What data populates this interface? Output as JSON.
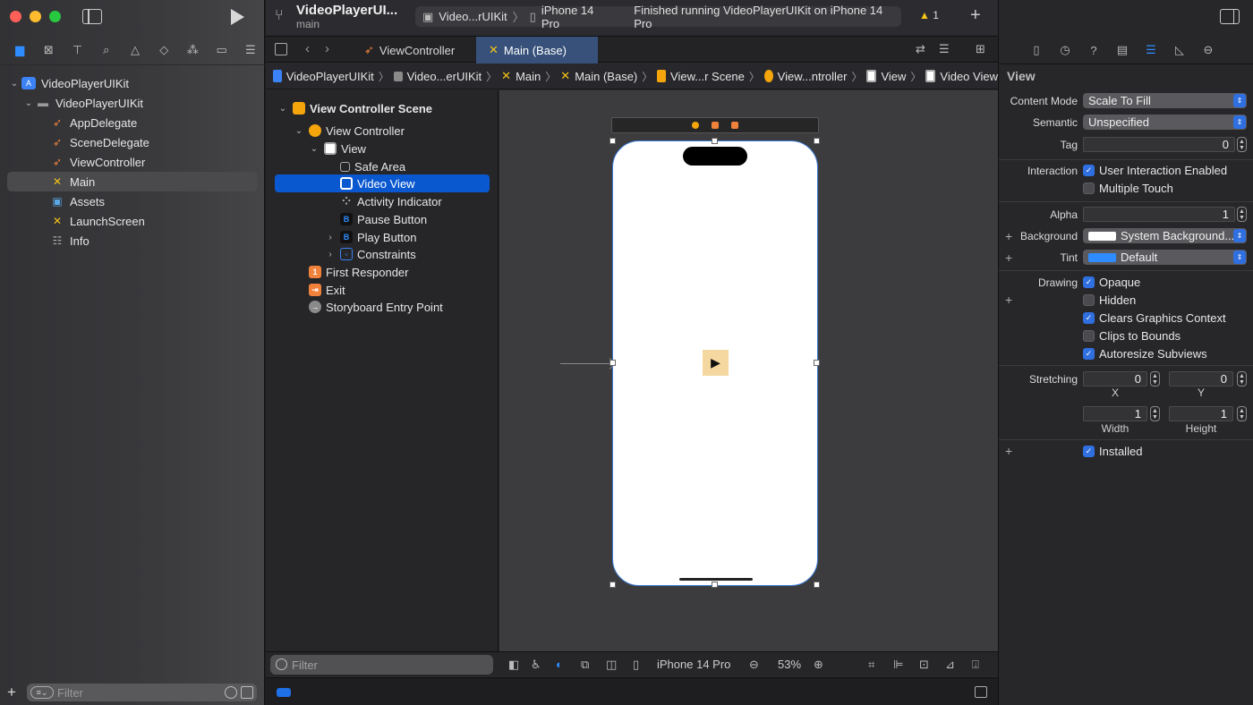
{
  "navigator": {
    "tabs": [
      "folder-icon",
      "source-control-icon",
      "symbol-icon",
      "search-icon",
      "issue-icon",
      "test-icon",
      "debug-icon",
      "breakpoint-icon",
      "report-icon"
    ],
    "tree": [
      {
        "label": "VideoPlayerUIKit",
        "level": 0,
        "icon": "project-icon",
        "chevron": "⌄"
      },
      {
        "label": "VideoPlayerUIKit",
        "level": 1,
        "icon": "folder-icon",
        "chevron": "⌄"
      },
      {
        "label": "AppDelegate",
        "level": 2,
        "icon": "swift-file-icon"
      },
      {
        "label": "SceneDelegate",
        "level": 2,
        "icon": "swift-file-icon"
      },
      {
        "label": "ViewController",
        "level": 2,
        "icon": "swift-file-icon"
      },
      {
        "label": "Main",
        "level": 2,
        "icon": "storyboard-icon",
        "selected": true
      },
      {
        "label": "Assets",
        "level": 2,
        "icon": "assets-icon"
      },
      {
        "label": "LaunchScreen",
        "level": 2,
        "icon": "storyboard-icon"
      },
      {
        "label": "Info",
        "level": 2,
        "icon": "plist-icon"
      }
    ],
    "filter_placeholder": "Filter"
  },
  "toolbar": {
    "project_title": "VideoPlayerUIKit",
    "project_title_display": "VideoPlayerUI...",
    "branch": "main",
    "scheme": "Video...rUIKit",
    "device": "iPhone 14 Pro",
    "status": "Finished running VideoPlayerUIKit on iPhone 14 Pro",
    "warning_count": "1"
  },
  "tabs": {
    "items": [
      {
        "label": "ViewController",
        "active": false
      },
      {
        "label": "Main (Base)",
        "active": true
      }
    ]
  },
  "jumpbar": [
    "VideoPlayerUIKit",
    "Video...erUIKit",
    "Main",
    "Main (Base)",
    "View...r Scene",
    "View...ntroller",
    "View",
    "Video View"
  ],
  "outline": {
    "rows": [
      {
        "label": "View Controller Scene",
        "chev": "⌄"
      },
      {
        "label": "View Controller",
        "chev": "⌄"
      },
      {
        "label": "View",
        "chev": "⌄"
      },
      {
        "label": "Safe Area",
        "chev": ""
      },
      {
        "label": "Video View",
        "chev": "",
        "selected": true
      },
      {
        "label": "Activity Indicator",
        "chev": ""
      },
      {
        "label": "Pause Button",
        "chev": ""
      },
      {
        "label": "Play Button",
        "chev": "›"
      },
      {
        "label": "Constraints",
        "chev": "›"
      },
      {
        "label": "First Responder",
        "chev": ""
      },
      {
        "label": "Exit",
        "chev": ""
      },
      {
        "label": "Storyboard Entry Point",
        "chev": ""
      }
    ],
    "filter_placeholder": "Filter"
  },
  "canvas": {
    "device_label": "iPhone 14 Pro",
    "zoom": "53%"
  },
  "inspector": {
    "header": "View",
    "content_mode_label": "Content Mode",
    "content_mode": "Scale To Fill",
    "semantic_label": "Semantic",
    "semantic": "Unspecified",
    "tag_label": "Tag",
    "tag": "0",
    "interaction_label": "Interaction",
    "user_interaction": "User Interaction Enabled",
    "multiple_touch": "Multiple Touch",
    "alpha_label": "Alpha",
    "alpha": "1",
    "background_label": "Background",
    "background": "System Background...",
    "tint_label": "Tint",
    "tint": "Default",
    "drawing_label": "Drawing",
    "opaque": "Opaque",
    "hidden": "Hidden",
    "clears_graphics": "Clears Graphics Context",
    "clips_to_bounds": "Clips to Bounds",
    "autoresize": "Autoresize Subviews",
    "stretching_label": "Stretching",
    "stretch_x": "0",
    "stretch_y": "0",
    "x_caption": "X",
    "y_caption": "Y",
    "stretch_w": "1",
    "stretch_h": "1",
    "width_caption": "Width",
    "height_caption": "Height",
    "installed": "Installed",
    "accent_color": "#2f6fe0"
  }
}
